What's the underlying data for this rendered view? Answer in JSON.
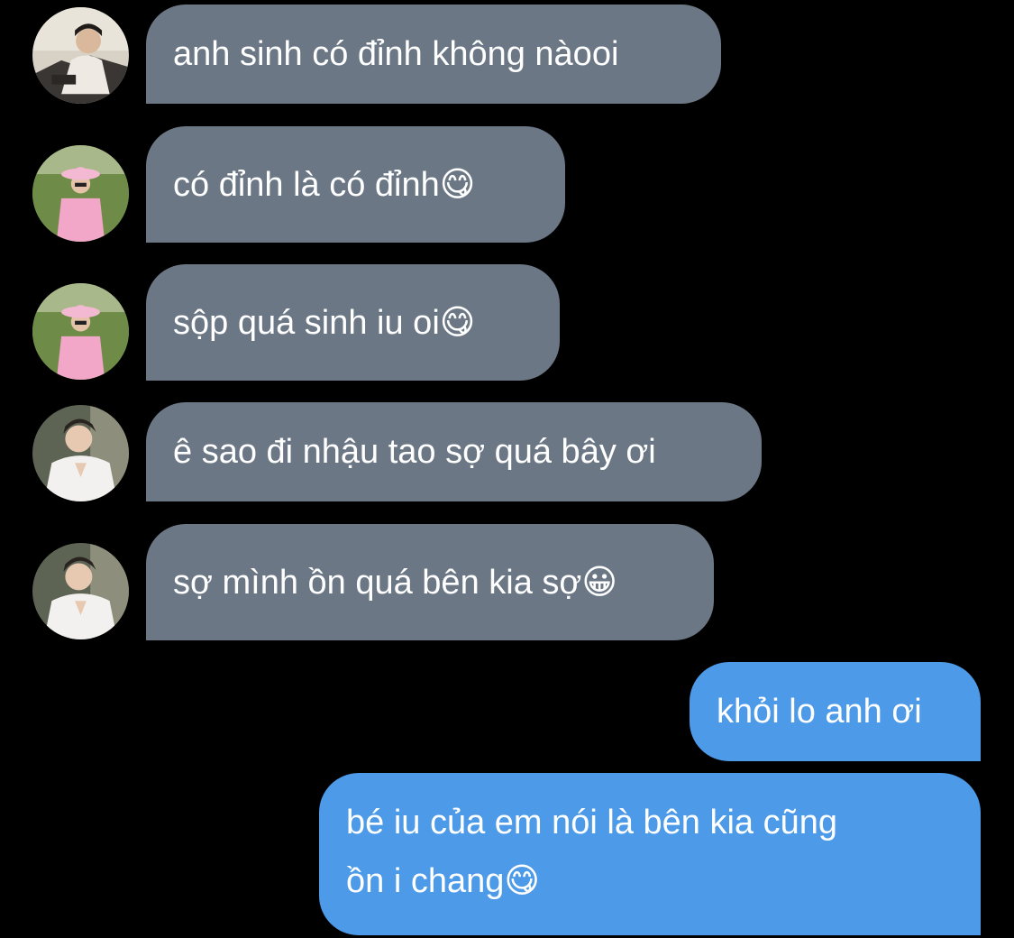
{
  "messages": [
    {
      "direction": "incoming",
      "avatar": "avatar-man-white-sweater",
      "text": "anh sinh có đỉnh không nàooi",
      "emoji": ""
    },
    {
      "direction": "incoming",
      "avatar": "avatar-person-pink-hat",
      "text": "có đỉnh là có đỉnh",
      "emoji": "😋"
    },
    {
      "direction": "incoming",
      "avatar": "avatar-person-pink-hat",
      "text": "sộp quá sinh iu oi",
      "emoji": "😋"
    },
    {
      "direction": "incoming",
      "avatar": "avatar-man-white-shirt",
      "text": "ê sao đi nhậu tao sợ quá bây ơi",
      "emoji": ""
    },
    {
      "direction": "incoming",
      "avatar": "avatar-man-white-shirt",
      "text": "sợ mình ồn quá bên kia sợ",
      "emoji": "😀"
    },
    {
      "direction": "outgoing",
      "text": "khỏi lo anh ơi",
      "emoji": ""
    },
    {
      "direction": "outgoing",
      "text_line1": "bé iu của em nói là bên kia cũng",
      "text_line2": "ồn i chang",
      "emoji": "😋"
    }
  ],
  "colors": {
    "background": "#000000",
    "incoming_bubble": "#6b7785",
    "outgoing_bubble": "#4c9ae8",
    "text": "#ffffff"
  }
}
